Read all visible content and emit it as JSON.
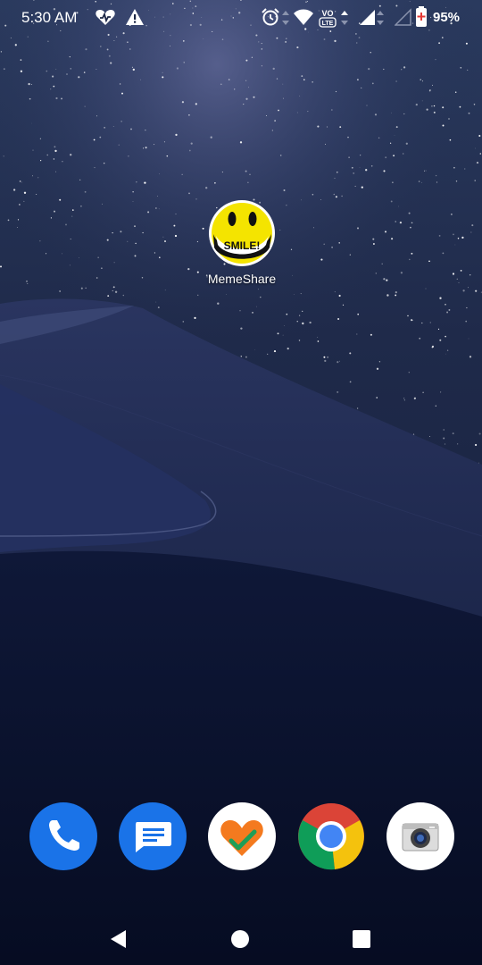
{
  "status_bar": {
    "time": "5:30 AM",
    "battery_percent": "95%",
    "network_label_top": "VO",
    "network_label_bottom": "LTE",
    "icons": [
      "health-icon",
      "warning-icon",
      "alarm-icon",
      "wifi-icon",
      "volte-icon",
      "signal-icon",
      "signal-icon-2",
      "battery-icon"
    ]
  },
  "home": {
    "apps": [
      {
        "label": "MemeShare",
        "icon": "smiley-icon",
        "icon_text": "SMILE!"
      }
    ]
  },
  "dock": {
    "apps": [
      {
        "icon": "phone-icon",
        "color": "#1a73e8"
      },
      {
        "icon": "messages-icon",
        "color": "#1a73e8"
      },
      {
        "icon": "health-app-icon",
        "color": "#ffffff"
      },
      {
        "icon": "chrome-icon",
        "color": "#ffffff"
      },
      {
        "icon": "camera-icon",
        "color": "#ffffff"
      }
    ]
  },
  "navigation": {
    "buttons": [
      "back-icon",
      "home-icon",
      "recents-icon"
    ]
  },
  "colors": {
    "sky": "#1f2f4f",
    "dune": "#0c1533",
    "smiley_yellow": "#f4e400"
  }
}
